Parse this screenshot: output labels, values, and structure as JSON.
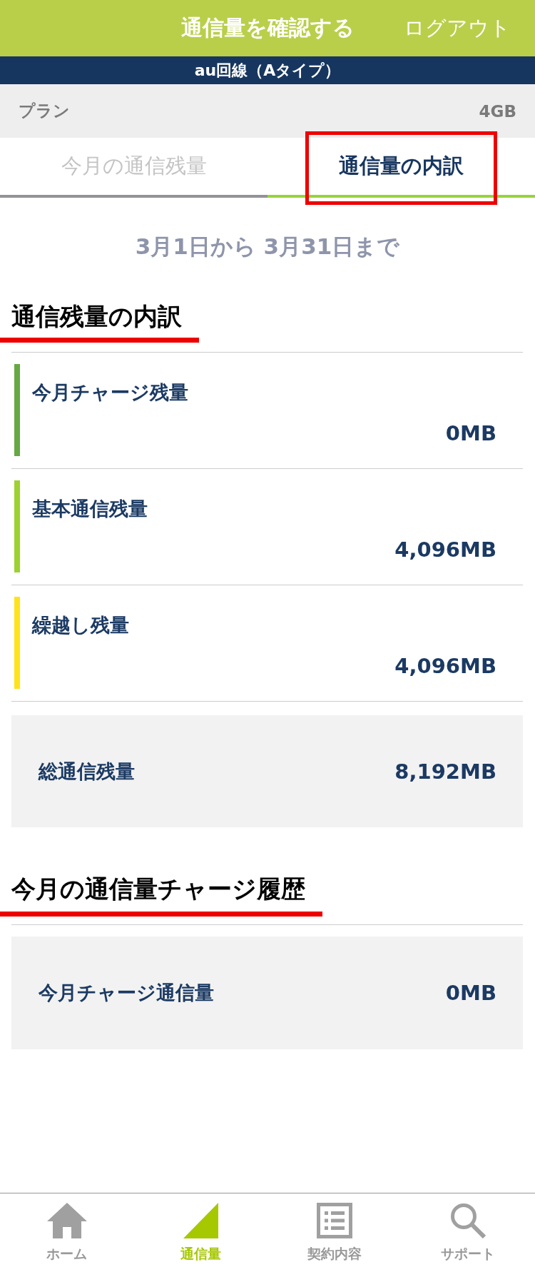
{
  "header": {
    "title": "通信量を確認する",
    "logout": "ログアウト"
  },
  "line_banner": {
    "label": "au回線（Aタイプ）"
  },
  "plan": {
    "label": "プラン",
    "value": "4GB"
  },
  "tabs": [
    {
      "label": "今月の通信残量",
      "selected": false,
      "highlighted": false
    },
    {
      "label": "通信量の内訳",
      "selected": true,
      "highlighted": true
    }
  ],
  "period": "3月1日から 3月31日まで",
  "breakdown": {
    "heading": "通信残量の内訳",
    "items": [
      {
        "label": "今月チャージ残量",
        "value": "0MB",
        "color": "#66a844"
      },
      {
        "label": "基本通信残量",
        "value": "4,096MB",
        "color": "#9dd12f"
      },
      {
        "label": "繰越し残量",
        "value": "4,096MB",
        "color": "#ffe31a"
      }
    ],
    "total": {
      "label": "総通信残量",
      "value": "8,192MB"
    }
  },
  "charge_history": {
    "heading": "今月の通信量チャージ履歴",
    "items": [
      {
        "label": "今月チャージ通信量",
        "value": "0MB"
      }
    ]
  },
  "bottom_nav": [
    {
      "label": "ホーム",
      "kind": "home",
      "selected": false
    },
    {
      "label": "通信量",
      "kind": "usage",
      "selected": true
    },
    {
      "label": "契約内容",
      "kind": "contract",
      "selected": false
    },
    {
      "label": "サポート",
      "kind": "support",
      "selected": false
    }
  ]
}
